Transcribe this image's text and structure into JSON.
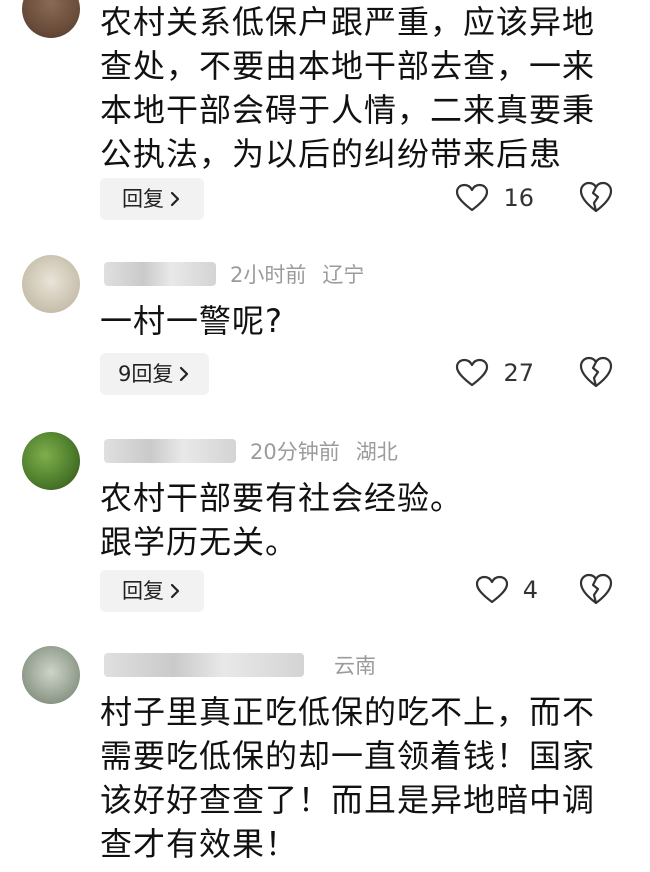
{
  "comments": [
    {
      "author": "",
      "time": "",
      "location": "",
      "text": "农村关系低保户跟严重，应该异地查处，不要由本地干部去查，一来本地干部会碍于人情，二来真要秉公执法，为以后的纠纷带来后患",
      "reply_label": "回复",
      "likes": "16"
    },
    {
      "author": "",
      "time": "2小时前",
      "location": "辽宁",
      "text": "一村一警呢?",
      "reply_label": "9回复",
      "likes": "27"
    },
    {
      "author": "",
      "time": "20分钟前",
      "location": "湖北",
      "text": "农村干部要有社会经验。\n跟学历无关。",
      "reply_label": "回复",
      "likes": "4"
    },
    {
      "author": "",
      "time": "",
      "location": "云南",
      "text": "村子里真正吃低保的吃不上，而不需要吃低保的却一直领着钱！国家该好好查查了！而且是异地暗中调查才有效果！",
      "reply_label": "",
      "likes": ""
    }
  ],
  "icons": {
    "reply_chevron": "chevron-right-icon",
    "like": "heart-icon",
    "dislike": "broken-heart-icon"
  },
  "colors": {
    "text": "#111111",
    "meta": "#9b9b9b",
    "reply_bg": "#f2f2f2"
  }
}
